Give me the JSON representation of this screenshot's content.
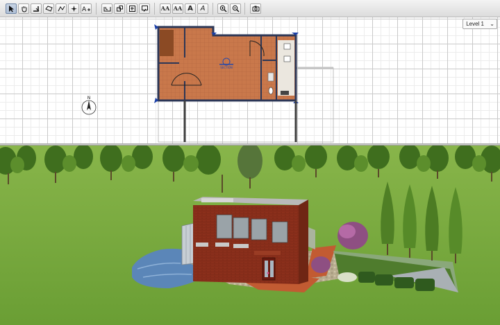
{
  "toolbar": {
    "groups": [
      [
        "select-tool",
        "pan-tool",
        "create-walls",
        "create-rooms",
        "create-polylines",
        "create-dimensions",
        "add-text"
      ],
      [
        "plan-mode-1",
        "plan-mode-2",
        "plan-mode-3",
        "plan-mode-4"
      ],
      [
        "increase-text-size",
        "decrease-text-size",
        "bold-text",
        "italic-text"
      ],
      [
        "zoom-in",
        "zoom-out"
      ],
      [
        "create-photo"
      ]
    ],
    "text_buttons": {
      "aa_large": "AA",
      "aa_small": "AA",
      "bold": "A",
      "italic": "A"
    }
  },
  "plan": {
    "level_selector": "Level 1",
    "compass_label": "N",
    "dimension_marker": "SECTION"
  },
  "colors": {
    "floor": "#c8774a",
    "wall": "#2c3a5c",
    "selection": "#1a3fa8",
    "grass": "#76a93c",
    "brick": "#8b2e1a"
  }
}
